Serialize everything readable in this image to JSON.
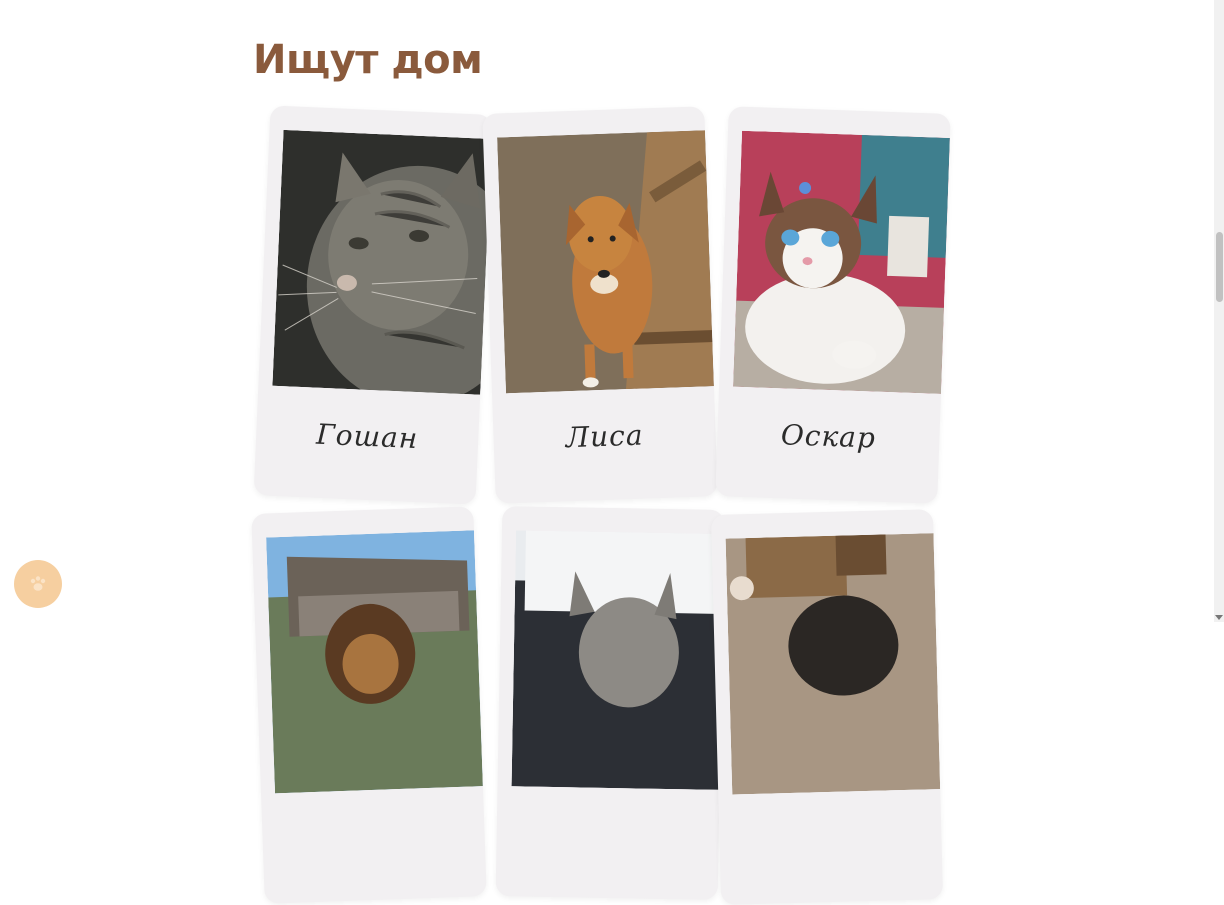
{
  "page": {
    "title": "Ищут дом"
  },
  "pets": [
    {
      "name": "Гошан",
      "icon": "tabby-cat-photo"
    },
    {
      "name": "Лиса",
      "icon": "ginger-dog-photo"
    },
    {
      "name": "Оскар",
      "icon": "siamese-cat-photo"
    },
    {
      "name": "",
      "icon": "shepherd-dog-photo"
    },
    {
      "name": "",
      "icon": "gray-cat-photo"
    },
    {
      "name": "",
      "icon": "dark-cat-photo"
    }
  ],
  "colors": {
    "title": "#8a5a3c",
    "card": "#f2f0f2",
    "fab": "#f6cfa0"
  },
  "fab": {
    "icon": "paw-icon"
  }
}
